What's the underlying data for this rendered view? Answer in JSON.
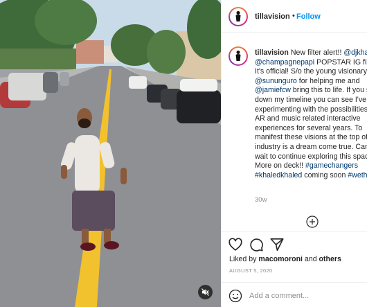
{
  "post": {
    "mute_icon": "speaker-muted-icon"
  },
  "header": {
    "username": "tillavision",
    "separator": "•",
    "follow_label": "Follow"
  },
  "caption": {
    "username": "tillavision",
    "text_1": " New filter alert!! ",
    "mention_1": "@djkhaled",
    "text_2": " ",
    "mention_2": "@champagnepapi",
    "text_3": " POPSTAR IG filter It's official! S/o the young visionary ",
    "mention_3": "@sununguro",
    "text_4": " for helping me and ",
    "mention_4": "@jamiefcw",
    "text_5": " bring this to life. If you scroll down my timeline you can see I've been experimenting with the possibilities of AR and music related interactive experiences for several years. To manifest these visions at the top of the industry is a dream come true. Can't wait to continue exploring this space. More on deck!! ",
    "hashtag_1": "#gamechangers",
    "text_6": " ",
    "hashtag_2": "#khaledkhaled",
    "text_7": " coming soon ",
    "hashtag_3": "#wethebest",
    "time_ago": "30w"
  },
  "actions": {
    "liked_by_prefix": "Liked by ",
    "liked_by_user": "macomoroni",
    "liked_by_and": " and ",
    "liked_by_others": "others",
    "date": "AUGUST 5, 2020"
  },
  "comment": {
    "placeholder": "Add a comment..."
  },
  "colors": {
    "link": "#00376b",
    "follow": "#0095f6",
    "secondary_text": "#8e8e8e",
    "road_line": "#f2c12e"
  }
}
